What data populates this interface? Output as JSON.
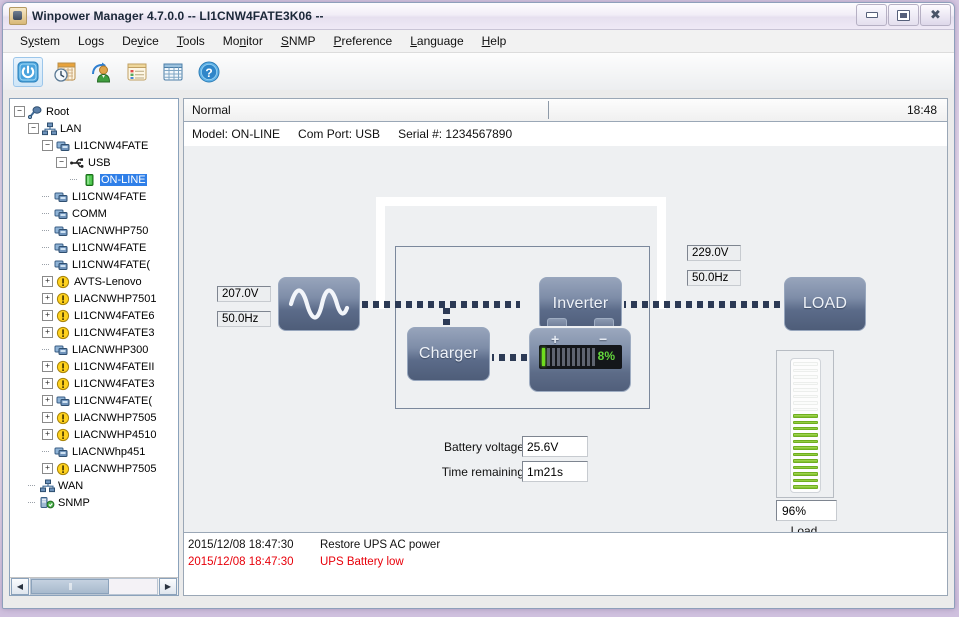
{
  "window": {
    "title": "Winpower Manager 4.7.0.0 -- LI1CNW4FATE3K06 --",
    "minimize": "–",
    "maximize": "❐",
    "close": "✕"
  },
  "menu": [
    {
      "label": "System",
      "mnemonic_index": 1
    },
    {
      "label": "Logs",
      "mnemonic_index": 2
    },
    {
      "label": "Device",
      "mnemonic_index": 2
    },
    {
      "label": "Tools",
      "mnemonic_index": 0
    },
    {
      "label": "Monitor",
      "mnemonic_index": 2
    },
    {
      "label": "SNMP",
      "mnemonic_index": 0
    },
    {
      "label": "Preference",
      "mnemonic_index": 0
    },
    {
      "label": "Language",
      "mnemonic_index": 0
    },
    {
      "label": "Help",
      "mnemonic_index": 0
    }
  ],
  "toolbar": [
    {
      "name": "power-icon",
      "tip": "UPS Power Control"
    },
    {
      "name": "schedule-clock-icon",
      "tip": "Schedule"
    },
    {
      "name": "user-action-icon",
      "tip": "User"
    },
    {
      "name": "event-list-icon",
      "tip": "Event Log"
    },
    {
      "name": "data-table-icon",
      "tip": "Data Log"
    },
    {
      "name": "help-icon",
      "tip": "Help"
    }
  ],
  "tree": [
    {
      "label": "Root",
      "depth": 0,
      "expander": "minus",
      "icon": "root-icon",
      "selected": false
    },
    {
      "label": "LAN",
      "depth": 1,
      "expander": "minus",
      "icon": "lan-icon",
      "selected": false
    },
    {
      "label": "LI1CNW4FATE",
      "depth": 2,
      "expander": "minus",
      "icon": "device-icon",
      "selected": false
    },
    {
      "label": "USB",
      "depth": 3,
      "expander": "minus",
      "icon": "usb-icon",
      "selected": false
    },
    {
      "label": "ON-LINE",
      "depth": 4,
      "expander": "none",
      "icon": "ups-icon",
      "selected": true
    },
    {
      "label": "LI1CNW4FATE",
      "depth": 2,
      "expander": "none",
      "icon": "device-icon",
      "selected": false
    },
    {
      "label": "COMM",
      "depth": 2,
      "expander": "none",
      "icon": "device-icon",
      "selected": false
    },
    {
      "label": "LIACNWHP750",
      "depth": 2,
      "expander": "none",
      "icon": "device-icon",
      "selected": false
    },
    {
      "label": "LI1CNW4FATE",
      "depth": 2,
      "expander": "none",
      "icon": "device-icon",
      "selected": false
    },
    {
      "label": "LI1CNW4FATE(",
      "depth": 2,
      "expander": "none",
      "icon": "device-icon",
      "selected": false
    },
    {
      "label": "AVTS-Lenovo",
      "depth": 2,
      "expander": "plus",
      "icon": "warn-icon",
      "selected": false
    },
    {
      "label": "LIACNWHP7501",
      "depth": 2,
      "expander": "plus",
      "icon": "warn-icon",
      "selected": false
    },
    {
      "label": "LI1CNW4FATE6",
      "depth": 2,
      "expander": "plus",
      "icon": "warn-icon",
      "selected": false
    },
    {
      "label": "LI1CNW4FATE3",
      "depth": 2,
      "expander": "plus",
      "icon": "warn-icon",
      "selected": false
    },
    {
      "label": "LIACNWHP300",
      "depth": 2,
      "expander": "none",
      "icon": "device-icon",
      "selected": false
    },
    {
      "label": "LI1CNW4FATEII",
      "depth": 2,
      "expander": "plus",
      "icon": "warn-icon",
      "selected": false
    },
    {
      "label": "LI1CNW4FATE3",
      "depth": 2,
      "expander": "plus",
      "icon": "warn-icon",
      "selected": false
    },
    {
      "label": "LI1CNW4FATE(",
      "depth": 2,
      "expander": "plus",
      "icon": "device-icon",
      "selected": false
    },
    {
      "label": "LIACNWHP7505",
      "depth": 2,
      "expander": "plus",
      "icon": "warn-icon",
      "selected": false
    },
    {
      "label": "LIACNWHP4510",
      "depth": 2,
      "expander": "plus",
      "icon": "warn-icon",
      "selected": false
    },
    {
      "label": "LIACNWhp451",
      "depth": 2,
      "expander": "none",
      "icon": "device-icon",
      "selected": false
    },
    {
      "label": "LIACNWHP7505",
      "depth": 2,
      "expander": "plus",
      "icon": "warn-icon",
      "selected": false
    },
    {
      "label": "WAN",
      "depth": 1,
      "expander": "none",
      "icon": "lan-icon",
      "selected": false
    },
    {
      "label": "SNMP",
      "depth": 1,
      "expander": "none",
      "icon": "snmp-icon",
      "selected": false
    }
  ],
  "statusbar": {
    "state": "Normal",
    "time": "18:48"
  },
  "deviceinfo": {
    "model": "Model: ON-LINE",
    "comport": "Com Port: USB",
    "serial": "Serial #: 1234567890"
  },
  "diagram": {
    "input": {
      "name": "AC input source",
      "voltage": "207.0V",
      "frequency": "50.0Hz"
    },
    "output": {
      "name": "AC output",
      "voltage": "229.0V",
      "frequency": "50.0Hz"
    },
    "inverter_label": "Inverter",
    "charger_label": "Charger",
    "load_label": "LOAD",
    "battery": {
      "percent_text": "8%",
      "percent": 8,
      "segments_total": 11,
      "segments_on": 1,
      "plus": "+",
      "minus": "−"
    },
    "battery_voltage": {
      "label": "Battery voltage",
      "value": "25.6V"
    },
    "time_remaining": {
      "label": "Time remaining",
      "value": "1m21s"
    },
    "load_meter": {
      "label": "Load",
      "value": "96%",
      "percent": 96,
      "segments_total": 20,
      "segments_on": 12
    }
  },
  "log": [
    {
      "timestamp": "2015/12/08 18:47:30",
      "message": "Restore UPS AC power",
      "alarm": false
    },
    {
      "timestamp": "2015/12/08 18:47:30",
      "message": "UPS Battery low",
      "alarm": true
    }
  ],
  "colors": {
    "accent_blue": "#2f7fe8",
    "alarm_red": "#e8000a",
    "battery_green": "#6fdc1e",
    "load_green": "#7ebe28",
    "node_blue": "#5b6b89",
    "diagram_bg": "#eef0f2"
  }
}
